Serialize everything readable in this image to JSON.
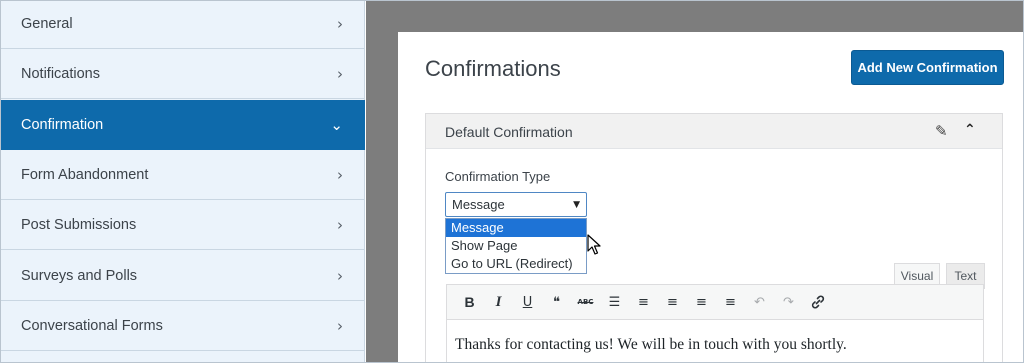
{
  "sidebar": {
    "items": [
      {
        "label": "General",
        "chevron": "›"
      },
      {
        "label": "Notifications",
        "chevron": "›"
      },
      {
        "label": "Confirmation",
        "chevron": "⌄",
        "active": true
      },
      {
        "label": "Form Abandonment",
        "chevron": "›"
      },
      {
        "label": "Post Submissions",
        "chevron": "›"
      },
      {
        "label": "Surveys and Polls",
        "chevron": "›"
      },
      {
        "label": "Conversational Forms",
        "chevron": "›"
      }
    ]
  },
  "panel": {
    "title": "Confirmations",
    "add_button": "Add New Confirmation"
  },
  "confirmation": {
    "title": "Default Confirmation",
    "pencil_glyph": "✎",
    "collapse_glyph": "⌃",
    "type_label": "Confirmation Type",
    "select_value": "Message",
    "select_caret": "▼",
    "options": [
      "Message",
      "Show Page",
      "Go to URL (Redirect)"
    ]
  },
  "editor": {
    "tabs": {
      "visual": "Visual",
      "text": "Text"
    },
    "toolbar": [
      {
        "name": "bold-button",
        "glyph": "B"
      },
      {
        "name": "italic-button",
        "glyph": "I"
      },
      {
        "name": "underline-button",
        "glyph": "U"
      },
      {
        "name": "blockquote-button",
        "glyph": "❝"
      },
      {
        "name": "strikethrough-button",
        "glyph": "ABC"
      },
      {
        "name": "bullet-list-button",
        "glyph": "☰"
      },
      {
        "name": "numbered-list-button",
        "glyph": "≡"
      },
      {
        "name": "align-left-button",
        "glyph": "≡"
      },
      {
        "name": "align-center-button",
        "glyph": "≡"
      },
      {
        "name": "align-right-button",
        "glyph": "≡"
      },
      {
        "name": "undo-button",
        "glyph": "↶"
      },
      {
        "name": "redo-button",
        "glyph": "↷"
      },
      {
        "name": "link-button",
        "glyph": "🔗"
      }
    ],
    "content": "Thanks for contacting us! We will be in touch with you shortly."
  },
  "colors": {
    "accent": "#0e6aab",
    "sidebar_bg": "#ebf3fb",
    "workspace_bg": "#7d7d7d",
    "option_highlight": "#1e73d6"
  }
}
